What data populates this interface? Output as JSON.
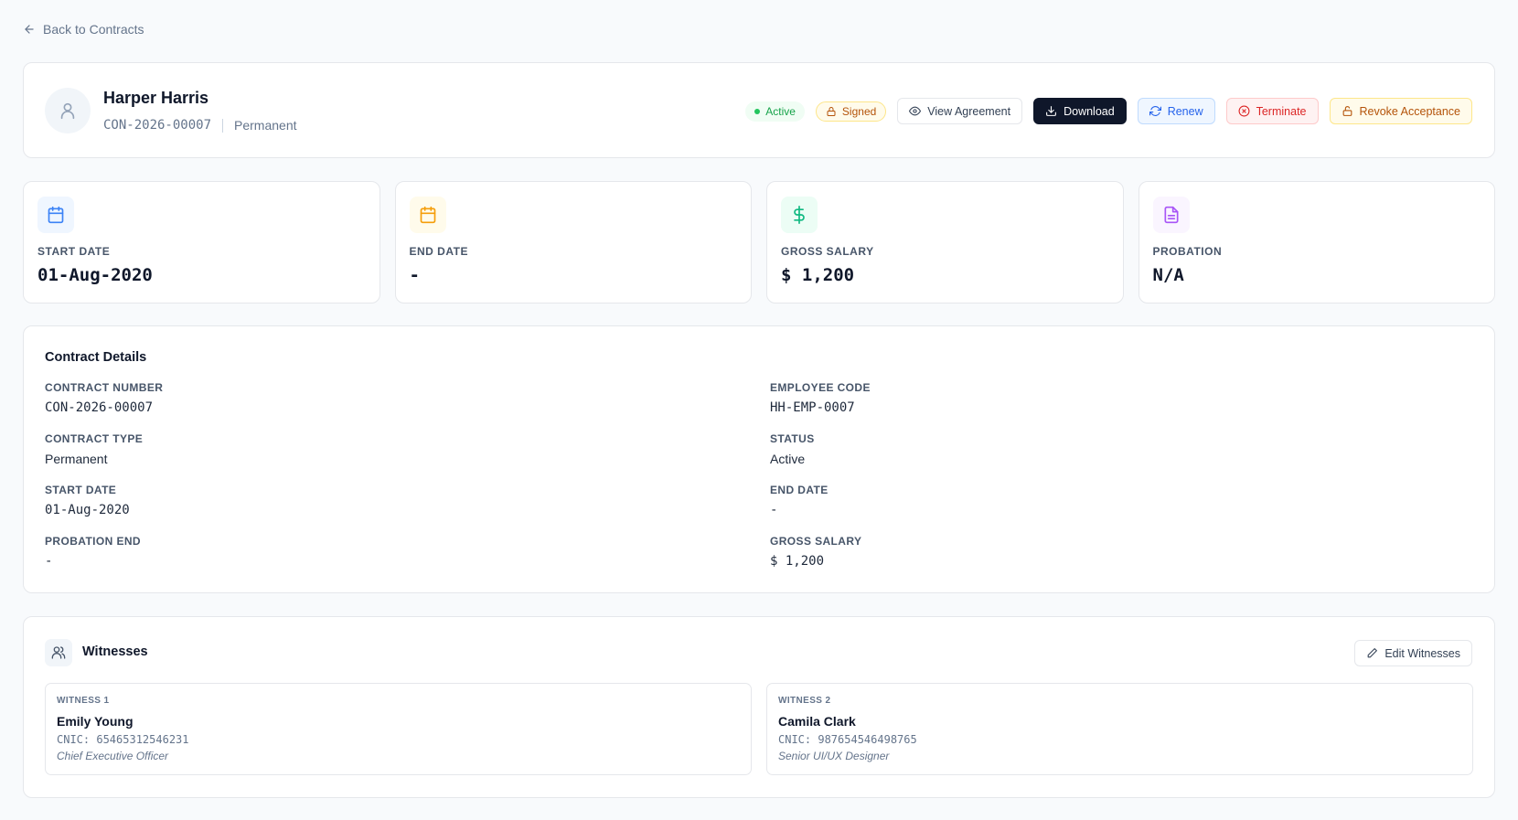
{
  "back_link": "Back to Contracts",
  "employee": {
    "name": "Harper Harris",
    "contract_code": "CON-2026-00007",
    "contract_type": "Permanent"
  },
  "badges": {
    "status": "Active",
    "signed": "Signed"
  },
  "actions": {
    "view_agreement": "View Agreement",
    "download": "Download",
    "renew": "Renew",
    "terminate": "Terminate",
    "revoke": "Revoke Acceptance"
  },
  "stats": [
    {
      "label": "START DATE",
      "value": "01-Aug-2020",
      "icon": "calendar-icon",
      "color": "#3b82f6"
    },
    {
      "label": "END DATE",
      "value": "-",
      "icon": "calendar-icon",
      "color": "#f59e0b"
    },
    {
      "label": "GROSS SALARY",
      "value": "$ 1,200",
      "icon": "dollar-icon",
      "color": "#10b981"
    },
    {
      "label": "PROBATION",
      "value": "N/A",
      "icon": "document-icon",
      "color": "#a855f7"
    }
  ],
  "details": {
    "title": "Contract Details",
    "left": [
      {
        "label": "CONTRACT NUMBER",
        "value": "CON-2026-00007"
      },
      {
        "label": "CONTRACT TYPE",
        "value": "Permanent"
      },
      {
        "label": "START DATE",
        "value": "01-Aug-2020"
      },
      {
        "label": "PROBATION END",
        "value": "-"
      }
    ],
    "right": [
      {
        "label": "EMPLOYEE CODE",
        "value": "HH-EMP-0007"
      },
      {
        "label": "STATUS",
        "value": "Active"
      },
      {
        "label": "END DATE",
        "value": "-"
      },
      {
        "label": "GROSS SALARY",
        "value": "$ 1,200"
      }
    ]
  },
  "witnesses": {
    "title": "Witnesses",
    "edit_label": "Edit Witnesses",
    "items": [
      {
        "label": "WITNESS 1",
        "name": "Emily Young",
        "cnic": "CNIC: 65465312546231",
        "role": "Chief Executive Officer"
      },
      {
        "label": "WITNESS 2",
        "name": "Camila Clark",
        "cnic": "CNIC: 987654546498765",
        "role": "Senior UI/UX Designer"
      }
    ]
  }
}
